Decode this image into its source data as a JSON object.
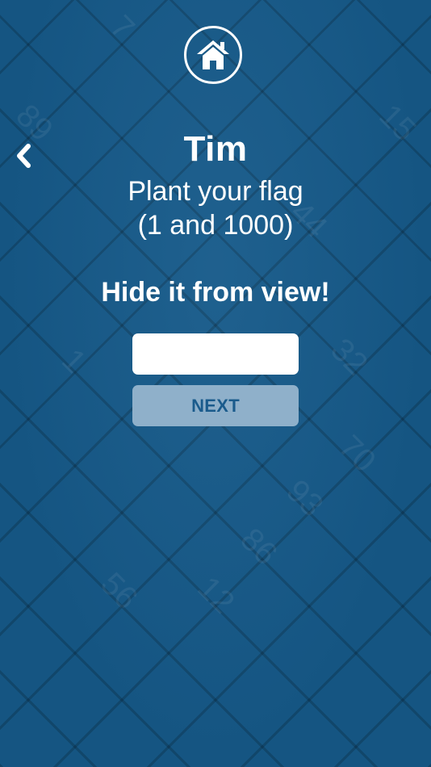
{
  "screen": {
    "background_color": "#165a8a",
    "accent_color": "#ffffff"
  },
  "nav": {
    "home_icon": "home-icon",
    "back_icon": "chevron-left-icon"
  },
  "player": {
    "name": "Tim"
  },
  "instruction": {
    "line1": "Plant your flag",
    "line2": "(1 and 1000)"
  },
  "hint": "Hide it from view!",
  "form": {
    "input_value": "",
    "input_placeholder": "",
    "next_label": "NEXT",
    "next_button_color": "#8fb0ca"
  }
}
